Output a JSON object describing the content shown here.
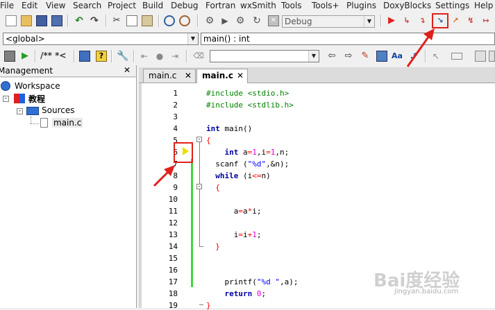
{
  "menu": [
    "File",
    "Edit",
    "View",
    "Search",
    "Project",
    "Build",
    "Debug",
    "Fortran",
    "wxSmith",
    "Tools",
    "Tools+",
    "Plugins",
    "DoxyBlocks",
    "Settings",
    "Help"
  ],
  "toolbar": {
    "build_target": "Debug",
    "scope": "<global>",
    "function": "main() : int",
    "doxy_comment": "/** *<",
    "text_search": ""
  },
  "colors": {
    "highlight": "#e0201b",
    "changebar": "#3ed63e",
    "keyword": "#0000a0",
    "preprocessor": "#008000",
    "string": "#0000ff",
    "number": "#e000e0"
  },
  "management": {
    "title": "Management",
    "close": "✕",
    "workspace": "Workspace",
    "project": "教程",
    "folder": "Sources",
    "file": "main.c"
  },
  "editor": {
    "tabs": [
      {
        "label": "main.c",
        "close": "✕"
      },
      {
        "label": "main.c",
        "close": "✕"
      }
    ],
    "current_line": "6",
    "lines": [
      {
        "num": "1",
        "tokens": [
          {
            "t": "#include <stdio.h>",
            "c": "pp"
          }
        ]
      },
      {
        "num": "2",
        "tokens": [
          {
            "t": "#include <stdlib.h>",
            "c": "pp"
          }
        ]
      },
      {
        "num": "3",
        "tokens": []
      },
      {
        "num": "4",
        "tokens": [
          {
            "t": "int",
            "c": "kw"
          },
          {
            "t": " main()",
            "c": ""
          }
        ]
      },
      {
        "num": "5",
        "tokens": [
          {
            "t": "{",
            "c": "op"
          }
        ]
      },
      {
        "num": "6",
        "tokens": [
          {
            "t": "    ",
            "c": ""
          },
          {
            "t": "int",
            "c": "kw"
          },
          {
            "t": " a",
            "c": ""
          },
          {
            "t": "=",
            "c": "op"
          },
          {
            "t": "1",
            "c": "num"
          },
          {
            "t": ",i",
            "c": ""
          },
          {
            "t": "=",
            "c": "op"
          },
          {
            "t": "1",
            "c": "num"
          },
          {
            "t": ",n;",
            "c": ""
          }
        ]
      },
      {
        "num": "7",
        "tokens": [
          {
            "t": "  scanf (",
            "c": ""
          },
          {
            "t": "\"%d\"",
            "c": "str"
          },
          {
            "t": ",&n);",
            "c": ""
          }
        ]
      },
      {
        "num": "8",
        "tokens": [
          {
            "t": "  ",
            "c": ""
          },
          {
            "t": "while",
            "c": "kw"
          },
          {
            "t": " (i",
            "c": ""
          },
          {
            "t": "<=",
            "c": "op"
          },
          {
            "t": "n)",
            "c": ""
          }
        ]
      },
      {
        "num": "9",
        "tokens": [
          {
            "t": "  {",
            "c": "op"
          }
        ]
      },
      {
        "num": "10",
        "tokens": []
      },
      {
        "num": "11",
        "tokens": [
          {
            "t": "      a",
            "c": ""
          },
          {
            "t": "=",
            "c": "op"
          },
          {
            "t": "a",
            "c": ""
          },
          {
            "t": "*",
            "c": "op"
          },
          {
            "t": "i;",
            "c": ""
          }
        ]
      },
      {
        "num": "12",
        "tokens": []
      },
      {
        "num": "13",
        "tokens": [
          {
            "t": "      i",
            "c": ""
          },
          {
            "t": "=",
            "c": "op"
          },
          {
            "t": "i",
            "c": ""
          },
          {
            "t": "+",
            "c": "op"
          },
          {
            "t": "1",
            "c": "num"
          },
          {
            "t": ";",
            "c": ""
          }
        ]
      },
      {
        "num": "14",
        "tokens": [
          {
            "t": "  }",
            "c": "op"
          }
        ]
      },
      {
        "num": "15",
        "tokens": []
      },
      {
        "num": "16",
        "tokens": []
      },
      {
        "num": "17",
        "tokens": [
          {
            "t": "    printf(",
            "c": ""
          },
          {
            "t": "\"%d \"",
            "c": "str"
          },
          {
            "t": ",a);",
            "c": ""
          }
        ]
      },
      {
        "num": "18",
        "tokens": [
          {
            "t": "    ",
            "c": ""
          },
          {
            "t": "return",
            "c": "kw"
          },
          {
            "t": " ",
            "c": ""
          },
          {
            "t": "0",
            "c": "num"
          },
          {
            "t": ";",
            "c": ""
          }
        ]
      },
      {
        "num": "19",
        "tokens": [
          {
            "t": "}",
            "c": "op"
          }
        ]
      }
    ]
  },
  "watermark": {
    "logo": "Bai度经验",
    "url": "jingyan.baidu.com"
  }
}
